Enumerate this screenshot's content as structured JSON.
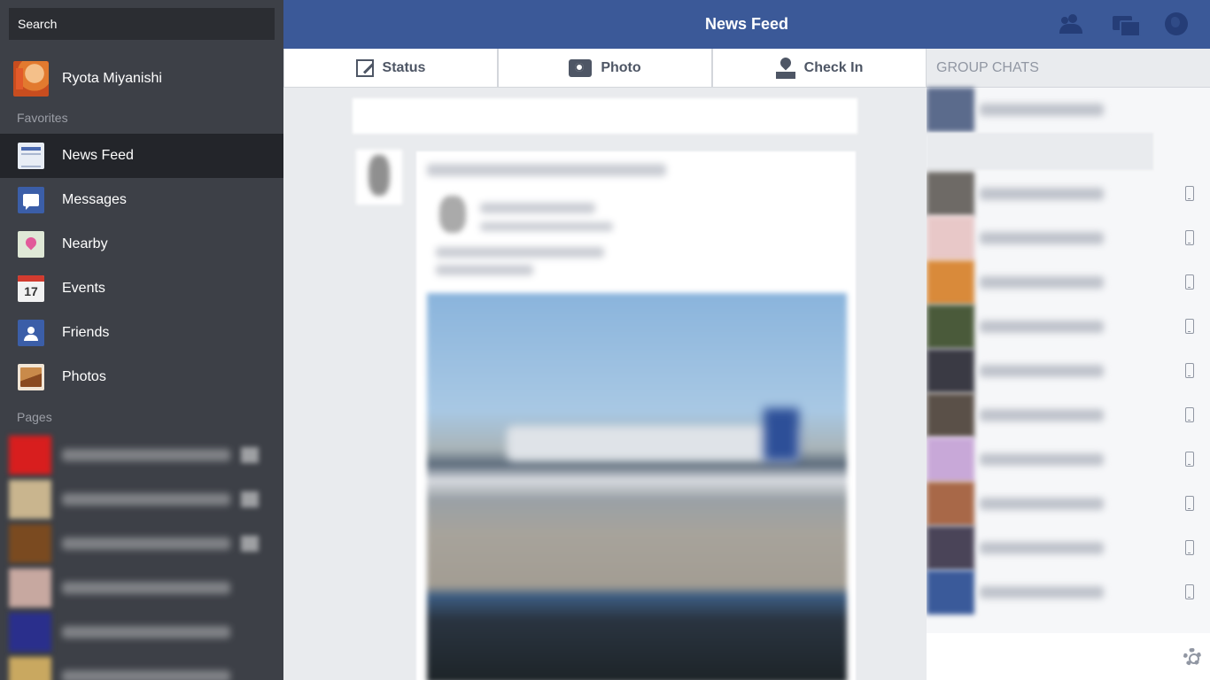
{
  "sidebar": {
    "search_placeholder": "Search",
    "profile_name": "Ryota Miyanishi",
    "favorites_label": "Favorites",
    "pages_label": "Pages",
    "items": [
      {
        "label": "News Feed",
        "icon": "news-feed-icon"
      },
      {
        "label": "Messages",
        "icon": "messages-icon"
      },
      {
        "label": "Nearby",
        "icon": "nearby-icon"
      },
      {
        "label": "Events",
        "icon": "calendar-icon",
        "icon_text": "17"
      },
      {
        "label": "Friends",
        "icon": "friends-icon"
      },
      {
        "label": "Photos",
        "icon": "photos-icon"
      }
    ]
  },
  "header": {
    "title": "News Feed",
    "color": "#3b5998"
  },
  "actions": {
    "status": "Status",
    "photo": "Photo",
    "checkin": "Check In"
  },
  "chat": {
    "group_chats_label": "GROUP CHATS"
  }
}
